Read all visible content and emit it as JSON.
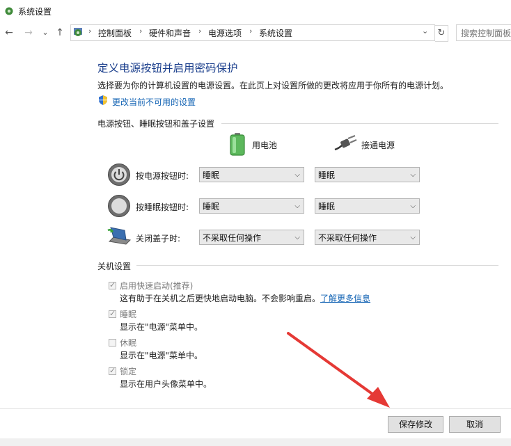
{
  "window": {
    "title": "系统设置"
  },
  "nav": {
    "back_icon": "←",
    "forward_icon": "→",
    "recent_icon": "⌄",
    "up_icon": "↑",
    "breadcrumbs": [
      "控制面板",
      "硬件和声音",
      "电源选项",
      "系统设置"
    ],
    "breadcrumb_sep": "›",
    "dropdown_icon": "⌄",
    "refresh_icon": "↻",
    "search_placeholder": "搜索控制面板"
  },
  "content": {
    "heading": "定义电源按钮并启用密码保护",
    "description": "选择要为你的计算机设置的电源设置。在此页上对设置所做的更改将应用于你所有的电源计划。",
    "change_link": "更改当前不可用的设置",
    "buttons_section": "电源按钮、睡眠按钮和盖子设置",
    "col_battery": "用电池",
    "col_plugged": "接通电源",
    "rows": [
      {
        "label": "按电源按钮时:",
        "battery": "睡眠",
        "plugged": "睡眠"
      },
      {
        "label": "按睡眠按钮时:",
        "battery": "睡眠",
        "plugged": "睡眠"
      },
      {
        "label": "关闭盖子时:",
        "battery": "不采取任何操作",
        "plugged": "不采取任何操作"
      }
    ],
    "combo_arrow": "⌵",
    "shutdown_section": "关机设置",
    "shutdown_items": [
      {
        "label": "启用快速启动(推荐)",
        "checked": true,
        "desc": "这有助于在关机之后更快地启动电脑。不会影响重启。",
        "link": "了解更多信息"
      },
      {
        "label": "睡眠",
        "checked": true,
        "desc": "显示在\"电源\"菜单中。"
      },
      {
        "label": "休眠",
        "checked": false,
        "desc": "显示在\"电源\"菜单中。"
      },
      {
        "label": "锁定",
        "checked": true,
        "desc": "显示在用户头像菜单中。"
      }
    ],
    "check_mark": "✓"
  },
  "footer": {
    "save": "保存修改",
    "cancel": "取消"
  },
  "colors": {
    "heading": "#1a3e8c",
    "link": "#1464b4",
    "arrow": "#e53935"
  }
}
